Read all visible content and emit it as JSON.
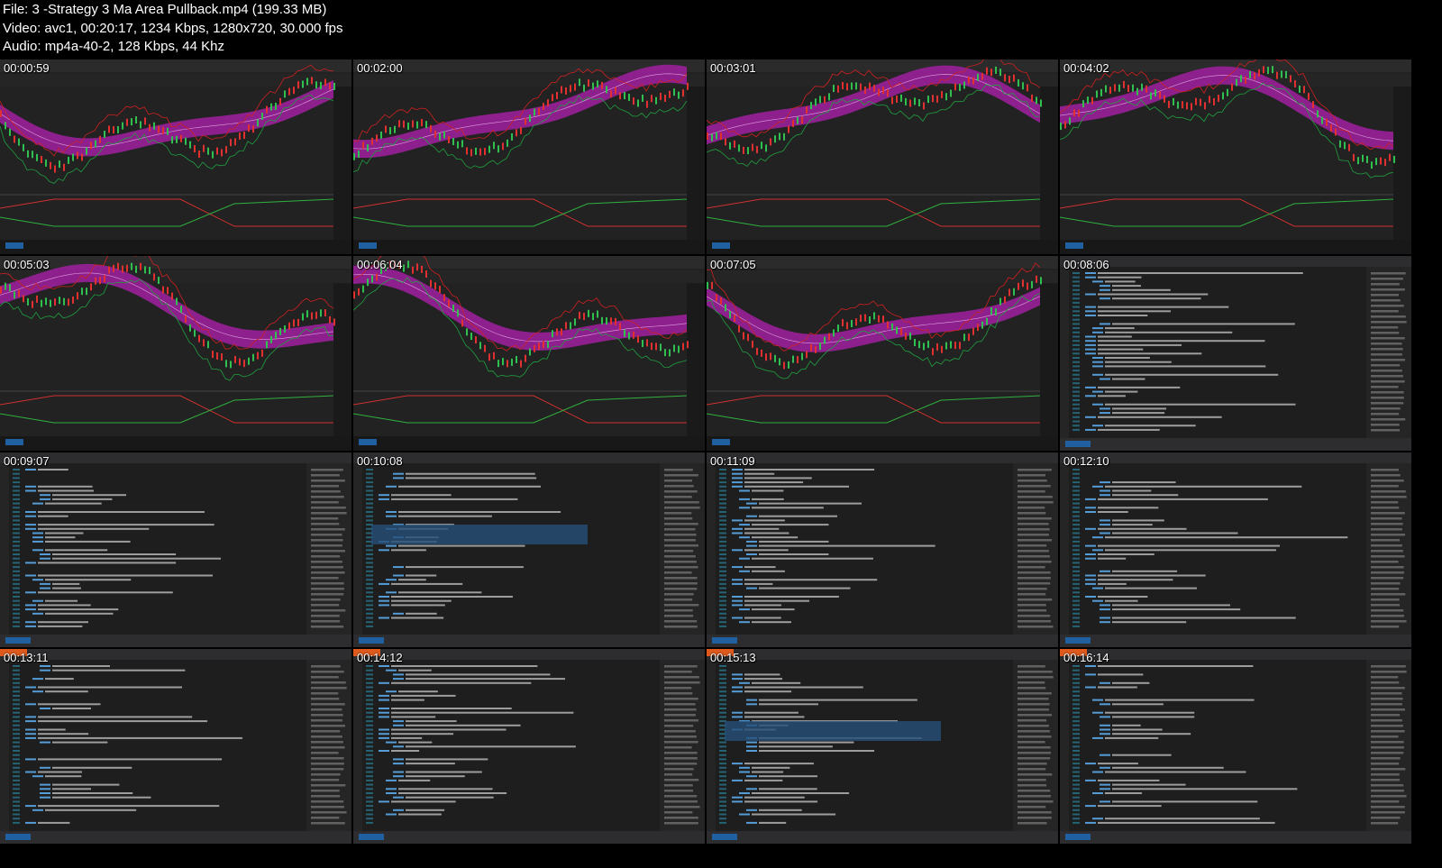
{
  "file_info": {
    "file_line": "File: 3 -Strategy 3 Ma Area Pullback.mp4 (199.33 MB)",
    "video_line": "Video: avc1, 00:20:17, 1234 Kbps, 1280x720, 30.000 fps",
    "audio_line": "Audio: mp4a-40-2, 128 Kbps, 44 Khz"
  },
  "frames": [
    {
      "timestamp": "00:00:59",
      "kind": "chart"
    },
    {
      "timestamp": "00:02:00",
      "kind": "chart"
    },
    {
      "timestamp": "00:03:01",
      "kind": "chart"
    },
    {
      "timestamp": "00:04:02",
      "kind": "chart"
    },
    {
      "timestamp": "00:05:03",
      "kind": "chart"
    },
    {
      "timestamp": "00:06:04",
      "kind": "chart"
    },
    {
      "timestamp": "00:07:05",
      "kind": "chart"
    },
    {
      "timestamp": "00:08:06",
      "kind": "code"
    },
    {
      "timestamp": "00:09:07",
      "kind": "code"
    },
    {
      "timestamp": "00:10:08",
      "kind": "code"
    },
    {
      "timestamp": "00:11:09",
      "kind": "code"
    },
    {
      "timestamp": "00:12:10",
      "kind": "code"
    },
    {
      "timestamp": "00:13:11",
      "kind": "code"
    },
    {
      "timestamp": "00:14:12",
      "kind": "code"
    },
    {
      "timestamp": "00:15:13",
      "kind": "code"
    },
    {
      "timestamp": "00:16:14",
      "kind": "code"
    }
  ],
  "colors": {
    "band": "#a020a0",
    "upper": "#d02020",
    "lower": "#20a040",
    "code_bg": "#1e1e1e",
    "accent": "#e05a1e"
  }
}
